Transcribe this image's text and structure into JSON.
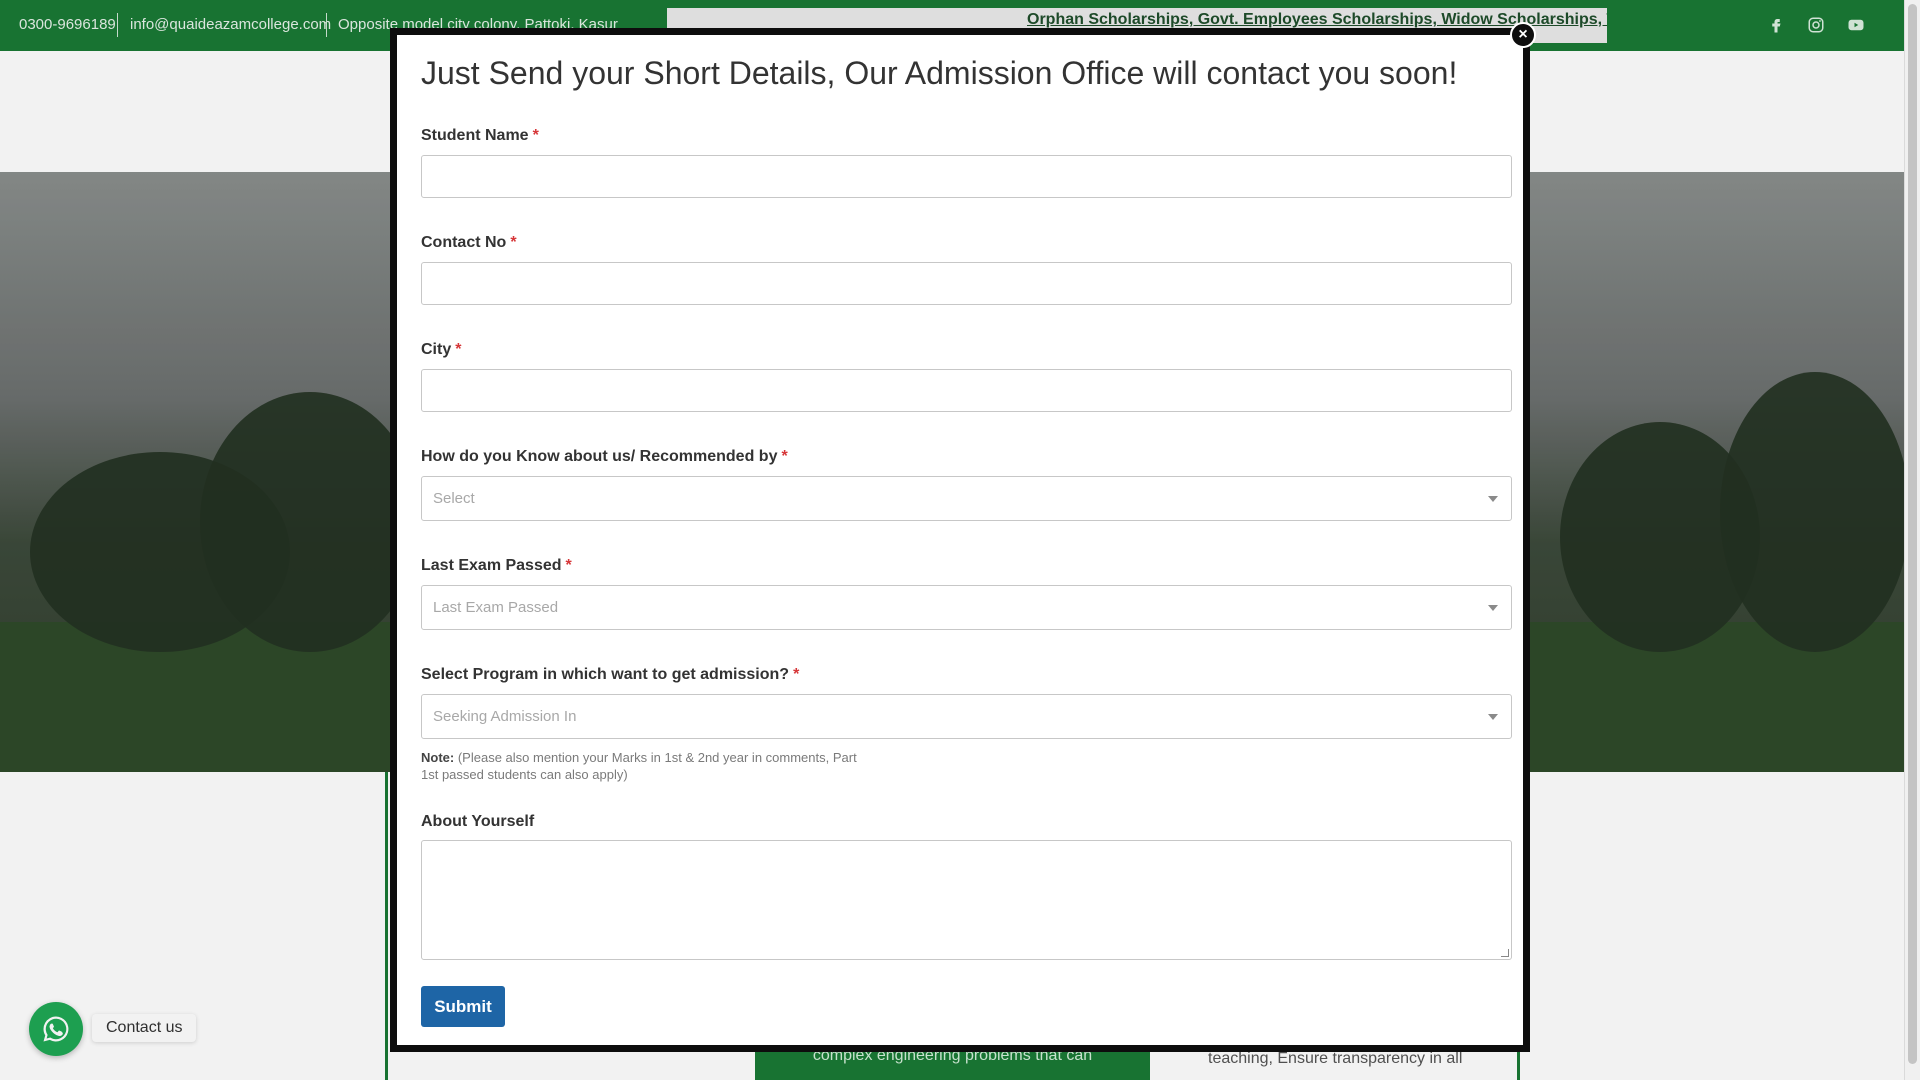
{
  "topbar": {
    "phone": "0300-9696189",
    "email": "info@quaideazamcollege.com",
    "address": "Opposite model city colony, Pattoki, Kasur",
    "ticker": "Orphan Scholarships, Govt. Employees Scholarships, Widow Scholarships, Teachers Scholarships"
  },
  "social": [
    "facebook-icon",
    "instagram-icon",
    "youtube-icon"
  ],
  "background": {
    "card_text": "complex engineering problems that can",
    "side_text": "teaching, Ensure transparency in all"
  },
  "contact_widget": {
    "label": "Contact us"
  },
  "modal": {
    "title": "Just Send your Short Details, Our Admission Office will contact you soon!",
    "close_label": "×",
    "fields": [
      {
        "label": "Student Name",
        "required_mark": "*"
      },
      {
        "label": "Contact No",
        "required_mark": "*"
      },
      {
        "label": "City",
        "required_mark": "*"
      },
      {
        "label": "How do you Know about us/ Recommended by",
        "required_mark": "*",
        "placeholder": "Select"
      },
      {
        "label": "Last Exam Passed",
        "required_mark": "*",
        "placeholder": "Last Exam Passed"
      },
      {
        "label": "Select Program in which want to get admission?",
        "required_mark": "*",
        "placeholder": "Seeking Admission In"
      },
      {
        "label": "About Yourself"
      }
    ],
    "note_label": "Note:",
    "note_text": "(Please also mention your Marks in 1st & 2nd year in comments, Part 1st passed students can also apply)",
    "submit_label": "Submit"
  },
  "colors": {
    "brand_green": "#1a7a35",
    "submit_blue": "#1e65a6",
    "required_red": "#d63638"
  }
}
